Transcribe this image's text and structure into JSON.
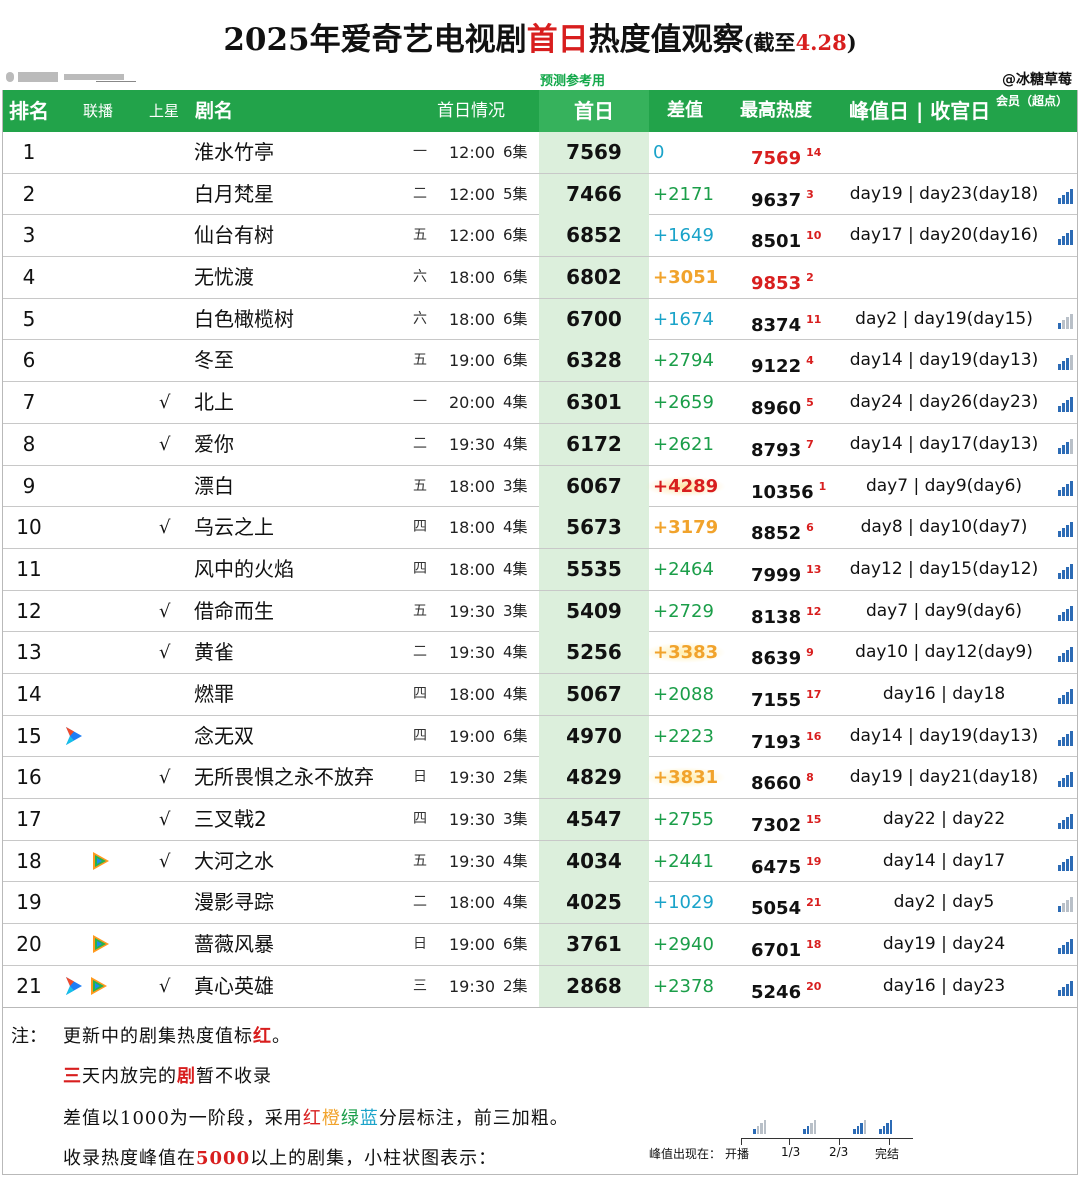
{
  "title": {
    "part1": "2025年爱奇艺电视剧",
    "part2": "首日",
    "part3": "热度值观察",
    "paren_open": "(截至",
    "date": "4.28",
    "paren_close": ")"
  },
  "subtitle": {
    "predict": "预测参考用",
    "author": "@冰糖草莓"
  },
  "headers": {
    "rank": "排名",
    "lianbo": "联播",
    "shangxing": "上星",
    "name": "剧名",
    "premiere": "首日情况",
    "first_day": "首日",
    "diff": "差值",
    "max": "最高热度",
    "peak": "峰值日 | 收官日",
    "member": "会员（超点）"
  },
  "colors": {
    "header_bg": "#22a34a",
    "first_day_col": "#dcefdc",
    "red": "#d81e1e",
    "orange": "#f1a32c",
    "green": "#1b9e49",
    "blue": "#1aa3c9"
  },
  "rows": [
    {
      "rank": "1",
      "check": "",
      "name": "淮水竹亭",
      "weekday": "一",
      "time": "12:00",
      "episodes": "6集",
      "first_day": "7569",
      "diff": "0",
      "diff_level": "zero",
      "max": "7569",
      "max_rank": "14",
      "max_red": true,
      "peak": "",
      "bars": 0,
      "icons": []
    },
    {
      "rank": "2",
      "check": "",
      "name": "白月梵星",
      "weekday": "二",
      "time": "12:00",
      "episodes": "5集",
      "first_day": "7466",
      "diff": "+2171",
      "diff_level": "green",
      "max": "9637",
      "max_rank": "3",
      "max_red": false,
      "peak": "day19 | day23(day18)",
      "bars": 4,
      "icons": []
    },
    {
      "rank": "3",
      "check": "",
      "name": "仙台有树",
      "weekday": "五",
      "time": "12:00",
      "episodes": "6集",
      "first_day": "6852",
      "diff": "+1649",
      "diff_level": "blue",
      "max": "8501",
      "max_rank": "10",
      "max_red": false,
      "peak": "day17 | day20(day16)",
      "bars": 4,
      "icons": []
    },
    {
      "rank": "4",
      "check": "",
      "name": "无忧渡",
      "weekday": "六",
      "time": "18:00",
      "episodes": "6集",
      "first_day": "6802",
      "diff": "+3051",
      "diff_level": "orange",
      "max": "9853",
      "max_rank": "2",
      "max_red": true,
      "peak": "",
      "bars": 0,
      "icons": []
    },
    {
      "rank": "5",
      "check": "",
      "name": "白色橄榄树",
      "weekday": "六",
      "time": "18:00",
      "episodes": "6集",
      "first_day": "6700",
      "diff": "+1674",
      "diff_level": "blue",
      "max": "8374",
      "max_rank": "11",
      "max_red": false,
      "peak": "day2 | day19(day15)",
      "bars": 1,
      "icons": []
    },
    {
      "rank": "6",
      "check": "",
      "name": "冬至",
      "weekday": "五",
      "time": "19:00",
      "episodes": "6集",
      "first_day": "6328",
      "diff": "+2794",
      "diff_level": "green",
      "max": "9122",
      "max_rank": "4",
      "max_red": false,
      "peak": "day14 | day19(day13)",
      "bars": 3,
      "icons": []
    },
    {
      "rank": "7",
      "check": "√",
      "name": "北上",
      "weekday": "一",
      "time": "20:00",
      "episodes": "4集",
      "first_day": "6301",
      "diff": "+2659",
      "diff_level": "green",
      "max": "8960",
      "max_rank": "5",
      "max_red": false,
      "peak": "day24 | day26(day23)",
      "bars": 4,
      "icons": []
    },
    {
      "rank": "8",
      "check": "√",
      "name": "爱你",
      "weekday": "二",
      "time": "19:30",
      "episodes": "4集",
      "first_day": "6172",
      "diff": "+2621",
      "diff_level": "green",
      "max": "8793",
      "max_rank": "7",
      "max_red": false,
      "peak": "day14 | day17(day13)",
      "bars": 3,
      "icons": []
    },
    {
      "rank": "9",
      "check": "",
      "name": "漂白",
      "weekday": "五",
      "time": "18:00",
      "episodes": "3集",
      "first_day": "6067",
      "diff": "+4289",
      "diff_level": "red",
      "max": "10356",
      "max_rank": "1",
      "max_red": false,
      "peak": "day7 | day9(day6)",
      "bars": 4,
      "icons": []
    },
    {
      "rank": "10",
      "check": "√",
      "name": "乌云之上",
      "weekday": "四",
      "time": "18:00",
      "episodes": "4集",
      "first_day": "5673",
      "diff": "+3179",
      "diff_level": "orange",
      "max": "8852",
      "max_rank": "6",
      "max_red": false,
      "peak": "day8 | day10(day7)",
      "bars": 4,
      "icons": []
    },
    {
      "rank": "11",
      "check": "",
      "name": "风中的火焰",
      "weekday": "四",
      "time": "18:00",
      "episodes": "4集",
      "first_day": "5535",
      "diff": "+2464",
      "diff_level": "green",
      "max": "7999",
      "max_rank": "13",
      "max_red": false,
      "peak": "day12 | day15(day12)",
      "bars": 4,
      "icons": []
    },
    {
      "rank": "12",
      "check": "√",
      "name": "借命而生",
      "weekday": "五",
      "time": "19:30",
      "episodes": "3集",
      "first_day": "5409",
      "diff": "+2729",
      "diff_level": "green",
      "max": "8138",
      "max_rank": "12",
      "max_red": false,
      "peak": "day7 | day9(day6)",
      "bars": 4,
      "icons": []
    },
    {
      "rank": "13",
      "check": "√",
      "name": "黄雀",
      "weekday": "二",
      "time": "19:30",
      "episodes": "4集",
      "first_day": "5256",
      "diff": "+3383",
      "diff_level": "orange-glow",
      "max": "8639",
      "max_rank": "9",
      "max_red": false,
      "peak": "day10 | day12(day9)",
      "bars": 4,
      "icons": []
    },
    {
      "rank": "14",
      "check": "",
      "name": "燃罪",
      "weekday": "四",
      "time": "18:00",
      "episodes": "4集",
      "first_day": "5067",
      "diff": "+2088",
      "diff_level": "green",
      "max": "7155",
      "max_rank": "17",
      "max_red": false,
      "peak": "day16 | day18",
      "bars": 4,
      "icons": []
    },
    {
      "rank": "15",
      "check": "",
      "name": "念无双",
      "weekday": "四",
      "time": "19:00",
      "episodes": "6集",
      "first_day": "4970",
      "diff": "+2223",
      "diff_level": "green",
      "max": "7193",
      "max_rank": "16",
      "max_red": false,
      "peak": "day14 | day19(day13)",
      "bars": 4,
      "icons": [
        "youku"
      ]
    },
    {
      "rank": "16",
      "check": "√",
      "name": "无所畏惧之永不放弃",
      "weekday": "日",
      "time": "19:30",
      "episodes": "2集",
      "first_day": "4829",
      "diff": "+3831",
      "diff_level": "orange-glow",
      "max": "8660",
      "max_rank": "8",
      "max_red": false,
      "peak": "day19 | day21(day18)",
      "bars": 4,
      "icons": []
    },
    {
      "rank": "17",
      "check": "√",
      "name": "三叉戟2",
      "weekday": "四",
      "time": "19:30",
      "episodes": "3集",
      "first_day": "4547",
      "diff": "+2755",
      "diff_level": "green",
      "max": "7302",
      "max_rank": "15",
      "max_red": false,
      "peak": "day22 | day22",
      "bars": 4,
      "icons": []
    },
    {
      "rank": "18",
      "check": "√",
      "name": "大河之水",
      "weekday": "五",
      "time": "19:30",
      "episodes": "4集",
      "first_day": "4034",
      "diff": "+2441",
      "diff_level": "green",
      "max": "6475",
      "max_rank": "19",
      "max_red": false,
      "peak": "day14 | day17",
      "bars": 4,
      "icons": [
        "tencent"
      ]
    },
    {
      "rank": "19",
      "check": "",
      "name": "漫影寻踪",
      "weekday": "二",
      "time": "18:00",
      "episodes": "4集",
      "first_day": "4025",
      "diff": "+1029",
      "diff_level": "blue",
      "max": "5054",
      "max_rank": "21",
      "max_red": false,
      "peak": "day2 | day5",
      "bars": 1,
      "icons": []
    },
    {
      "rank": "20",
      "check": "",
      "name": "蔷薇风暴",
      "weekday": "日",
      "time": "19:00",
      "episodes": "6集",
      "first_day": "3761",
      "diff": "+2940",
      "diff_level": "green",
      "max": "6701",
      "max_rank": "18",
      "max_red": false,
      "peak": "day19 | day24",
      "bars": 4,
      "icons": [
        "tencent"
      ]
    },
    {
      "rank": "21",
      "check": "√",
      "name": "真心英雄",
      "weekday": "三",
      "time": "19:30",
      "episodes": "2集",
      "first_day": "2868",
      "diff": "+2378",
      "diff_level": "green",
      "max": "5246",
      "max_rank": "20",
      "max_red": false,
      "peak": "day16 | day23",
      "bars": 4,
      "icons": [
        "youku",
        "tencent"
      ]
    }
  ],
  "notes": {
    "label": "注：",
    "line1_a": "更新中的剧集热度值标",
    "line1_b": "红",
    "line1_c": "。",
    "line2_a": "三",
    "line2_b": "天内放完的",
    "line2_c": "剧",
    "line2_d": "暂不收录",
    "line3_a": "差值以1000为一阶段，采用",
    "line3_r": "红",
    "line3_o": "橙",
    "line3_g": "绿",
    "line3_b": "蓝",
    "line3_c": "分层标注，前三加粗。",
    "line4_a": "收录热度峰值在",
    "line4_b": "5000",
    "line4_c": "以上的剧集，小柱状图表示：",
    "legend_title": "峰值出现在：",
    "legend_start": "开播",
    "legend_third": "1/3",
    "legend_two_thirds": "2/3",
    "legend_end": "完结"
  }
}
